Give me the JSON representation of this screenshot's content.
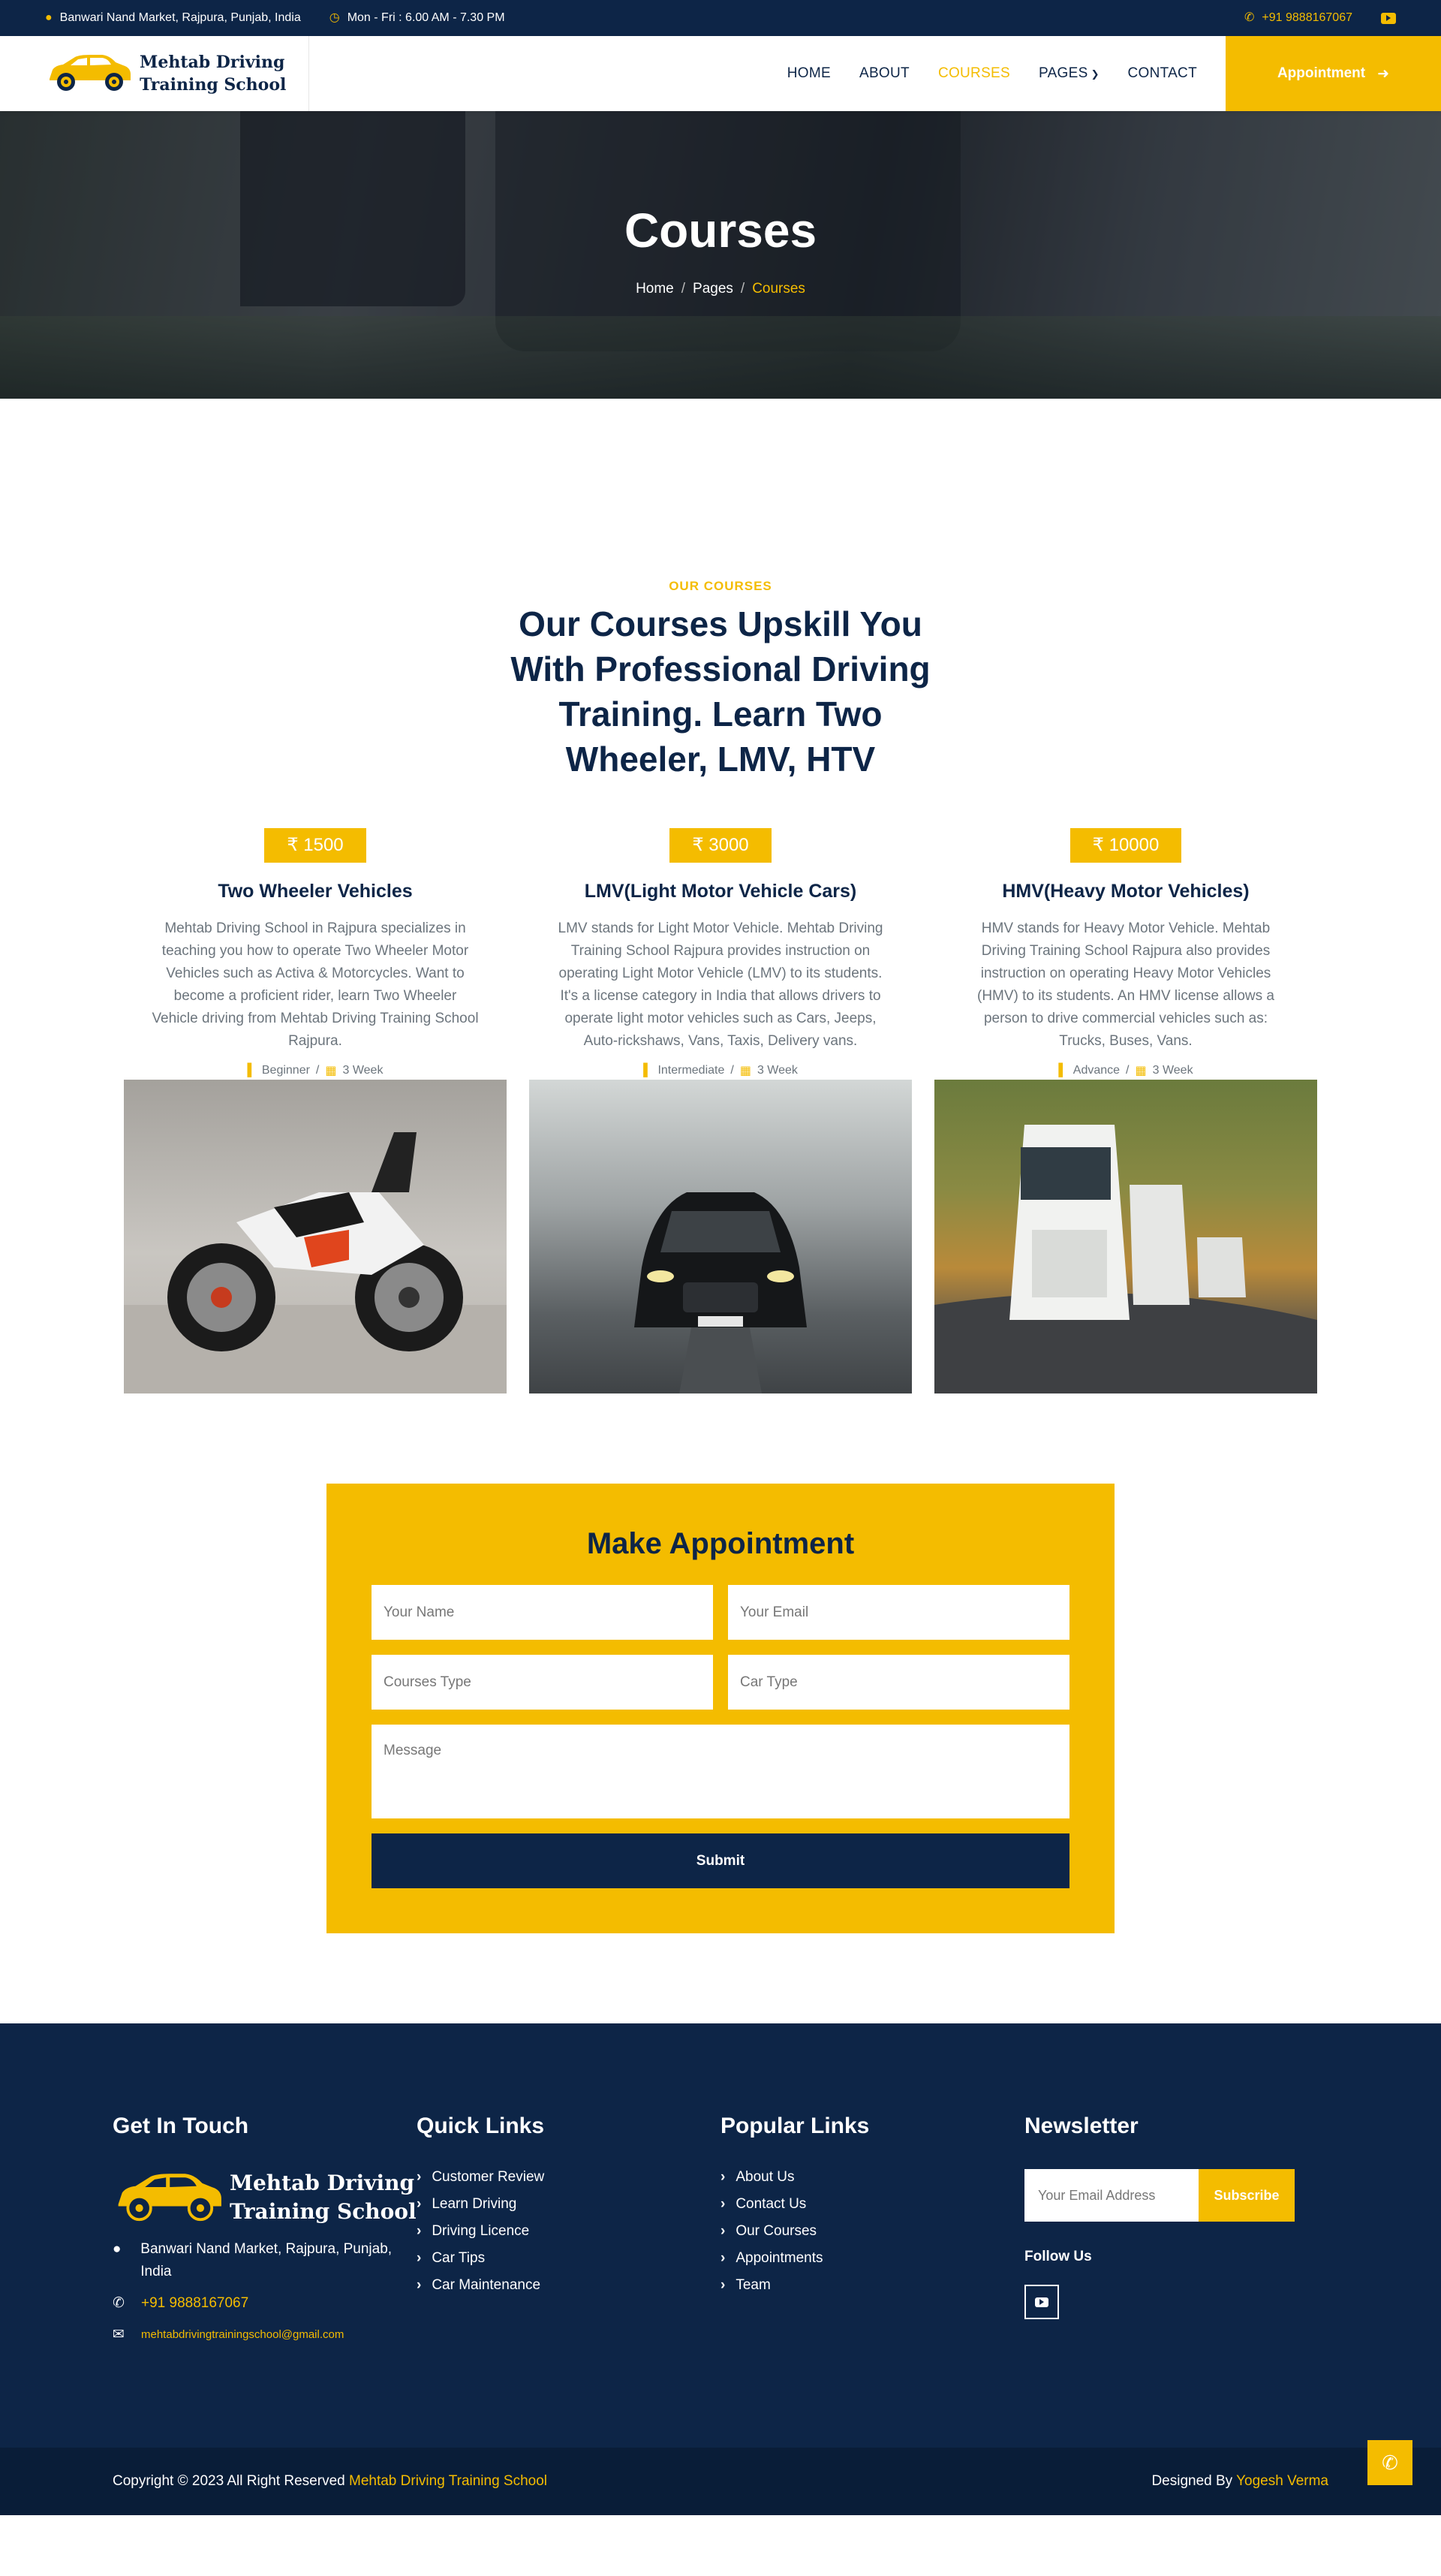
{
  "topbar": {
    "address": "Banwari Nand Market, Rajpura, Punjab, India",
    "hours": "Mon - Fri : 6.00 AM - 7.30 PM",
    "phone": "+91 9888167067"
  },
  "brand": {
    "line1": "Mehtab Driving",
    "line2": "Training School"
  },
  "nav": {
    "items": [
      "HOME",
      "ABOUT",
      "COURSES",
      "PAGES",
      "CONTACT"
    ],
    "active": "COURSES",
    "cta": "Appointment"
  },
  "hero": {
    "title": "Courses",
    "breadcrumb": [
      "Home",
      "Pages",
      "Courses"
    ],
    "sep": "/"
  },
  "courses": {
    "eyebrow": "OUR COURSES",
    "title": "Our Courses Upskill You With Professional Driving Training. Learn Two Wheeler, LMV, HTV",
    "cards": [
      {
        "price": "₹ 1500",
        "title": "Two Wheeler Vehicles",
        "desc": "Mehtab Driving School in Rajpura specializes in teaching you how to operate Two Wheeler Motor Vehicles such as Activa & Motorcycles. Want to become a proficient rider, learn Two Wheeler Vehicle driving from Mehtab Driving Training School Rajpura.",
        "level": "Beginner",
        "duration": "3 Week"
      },
      {
        "price": "₹ 3000",
        "title": "LMV(Light Motor Vehicle Cars)",
        "desc": "LMV stands for Light Motor Vehicle. Mehtab Driving Training School Rajpura provides instruction on operating Light Motor Vehicle (LMV) to its students. It's a license category in India that allows drivers to operate light motor vehicles such as Cars, Jeeps, Auto-rickshaws, Vans, Taxis, Delivery vans.",
        "level": "Intermediate",
        "duration": "3 Week"
      },
      {
        "price": "₹ 10000",
        "title": "HMV(Heavy Motor Vehicles)",
        "desc": "HMV stands for Heavy Motor Vehicle. Mehtab Driving Training School Rajpura also provides instruction on operating Heavy Motor Vehicles (HMV) to its students. An HMV license allows a person to drive commercial vehicles such as: Trucks, Buses, Vans.",
        "level": "Advance",
        "duration": "3 Week"
      }
    ]
  },
  "appointment": {
    "title": "Make Appointment",
    "fields": {
      "name": "Your Name",
      "email": "Your Email",
      "course": "Courses Type",
      "car": "Car Type",
      "message": "Message"
    },
    "submit": "Submit"
  },
  "footer": {
    "touch_title": "Get In Touch",
    "address": "Banwari Nand Market, Rajpura, Punjab, India",
    "phone": "+91 9888167067",
    "email": "mehtabdrivingtrainingschool@gmail.com",
    "quick_title": "Quick Links",
    "quick_links": [
      "Customer Review",
      "Learn Driving",
      "Driving Licence",
      "Car Tips",
      "Car Maintenance"
    ],
    "popular_title": "Popular Links",
    "popular_links": [
      "About Us",
      "Contact Us",
      "Our Courses",
      "Appointments",
      "Team"
    ],
    "news_title": "Newsletter",
    "news_placeholder": "Your Email Address",
    "news_button": "Subscribe",
    "follow": "Follow Us"
  },
  "bottom": {
    "copyright": "Copyright © 2023 All Right Reserved",
    "school": "Mehtab Driving Training School",
    "designed": "Designed By",
    "designer": "Yogesh Verma"
  },
  "colors": {
    "navy": "#0d2547",
    "accent": "#f4bc00"
  }
}
